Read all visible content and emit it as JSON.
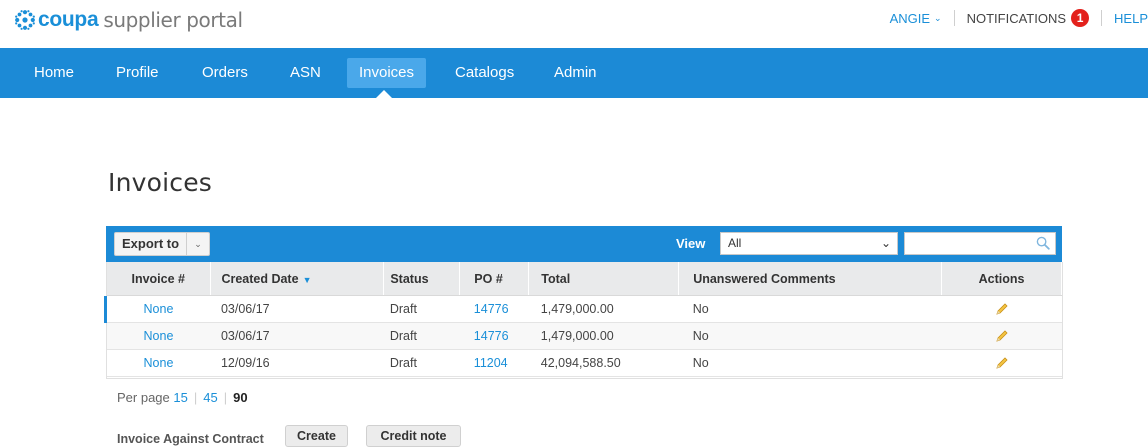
{
  "brand": {
    "name": "coupa",
    "tagline": "supplier portal",
    "logo_icon": "snowflake-icon",
    "color": "#1a8fd8"
  },
  "utility": {
    "user": "ANGIE",
    "notifications_label": "NOTIFICATIONS",
    "notifications_count": "1",
    "help_label": "HELP"
  },
  "nav": {
    "items": [
      {
        "label": "Home"
      },
      {
        "label": "Profile"
      },
      {
        "label": "Orders"
      },
      {
        "label": "ASN"
      },
      {
        "label": "Invoices"
      },
      {
        "label": "Catalogs"
      },
      {
        "label": "Admin"
      }
    ],
    "active": "Invoices",
    "bar_color": "#1c8ad6"
  },
  "page": {
    "title": "Invoices"
  },
  "toolbar": {
    "export_label": "Export to",
    "view_label": "View",
    "view_selected": "All",
    "search_value": "",
    "search_placeholder": ""
  },
  "table": {
    "columns": [
      "Invoice #",
      "Created Date",
      "Status",
      "PO #",
      "Total",
      "Unanswered Comments",
      "Actions"
    ],
    "sorted_by": "Created Date",
    "rows": [
      {
        "invoice": "None",
        "created": "03/06/17",
        "status": "Draft",
        "po": "14776",
        "total": "1,479,000.00",
        "comments": "No",
        "action_icon": "pencil-icon"
      },
      {
        "invoice": "None",
        "created": "03/06/17",
        "status": "Draft",
        "po": "14776",
        "total": "1,479,000.00",
        "comments": "No",
        "action_icon": "pencil-icon"
      },
      {
        "invoice": "None",
        "created": "12/09/16",
        "status": "Draft",
        "po": "11204",
        "total": "42,094,588.50",
        "comments": "No",
        "action_icon": "pencil-icon"
      }
    ]
  },
  "pagination": {
    "label": "Per page",
    "options": [
      "15",
      "45",
      "90"
    ],
    "current": "90"
  },
  "bottom": {
    "label": "Invoice Against Contract",
    "create_label": "Create",
    "credit_note_label": "Credit note"
  }
}
